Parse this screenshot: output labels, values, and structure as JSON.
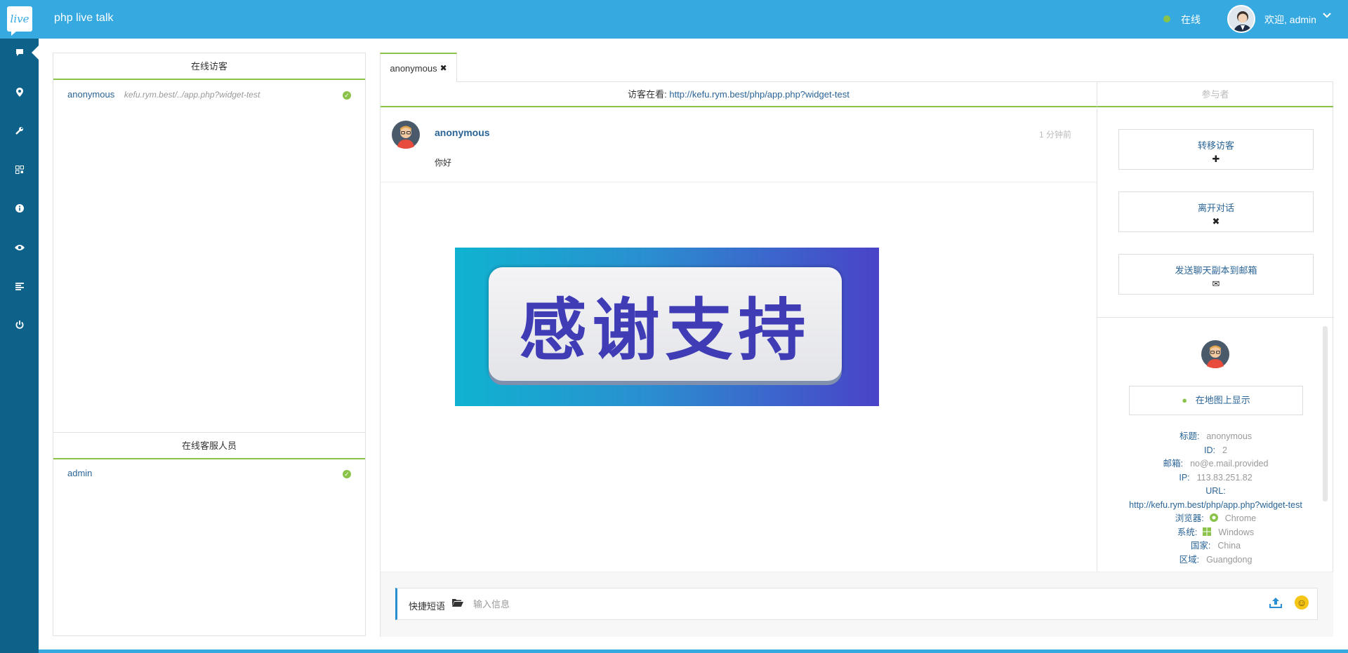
{
  "app": {
    "logo_text": "live",
    "title": "php live talk"
  },
  "header": {
    "status": "在线",
    "status_color": "#8bc34a",
    "welcome": "欢迎, admin",
    "caret": "⌄"
  },
  "sidebar": {
    "items": [
      {
        "icon": "chat-icon",
        "glyph": "▬",
        "active": true
      },
      {
        "icon": "location-pin-icon",
        "glyph": "●"
      },
      {
        "icon": "wrench-icon",
        "glyph": "✎"
      },
      {
        "icon": "qrcode-icon",
        "glyph": "▦"
      },
      {
        "icon": "info-icon",
        "glyph": "ℹ"
      },
      {
        "icon": "eye-icon",
        "glyph": "◉"
      },
      {
        "icon": "list-icon",
        "glyph": "≡"
      },
      {
        "icon": "power-icon",
        "glyph": "⏻"
      }
    ]
  },
  "visitors": {
    "title": "在线访客",
    "items": [
      {
        "name": "anonymous",
        "url": "kefu.rym.best/../app.php?widget-test"
      }
    ]
  },
  "agents": {
    "title": "在线客服人员",
    "items": [
      {
        "name": "admin"
      }
    ]
  },
  "chat": {
    "tab_label": "anonymous",
    "tab_close": "✖",
    "viewing_label": "访客在看:",
    "viewing_url": "http://kefu.rym.best/php/app.php?widget-test",
    "participants_label": "参与者",
    "message": {
      "author": "anonymous",
      "time": "1 分钟前",
      "text": "你好"
    },
    "image_text": "感谢支持"
  },
  "actions": {
    "transfer": {
      "label": "转移访客",
      "glyph": "✚"
    },
    "leave": {
      "label": "离开对话",
      "glyph": "✖"
    },
    "email": {
      "label": "发送聊天副本到邮箱",
      "glyph": "✉"
    }
  },
  "profile": {
    "map_button": "在地图上显示",
    "fields": {
      "title_k": "标题:",
      "title_v": "anonymous",
      "id_k": "ID:",
      "id_v": "2",
      "email_k": "邮箱:",
      "email_v": "no@e.mail.provided",
      "ip_k": "IP:",
      "ip_v": "113.83.251.82",
      "url_k": "URL:",
      "url_v": "http://kefu.rym.best/php/app.php?widget-test",
      "browser_k": "浏览器:",
      "browser_v": "Chrome",
      "os_k": "系统:",
      "os_v": "Windows",
      "country_k": "国家:",
      "country_v": "China",
      "region_k": "区域:",
      "region_v": "Guangdong"
    }
  },
  "input": {
    "quick_label": "快捷短语",
    "placeholder": "输入信息"
  },
  "colors": {
    "primary": "#36a9e1",
    "sidebar": "#0e6289",
    "accent": "#8bc34a",
    "link": "#2a6496"
  }
}
